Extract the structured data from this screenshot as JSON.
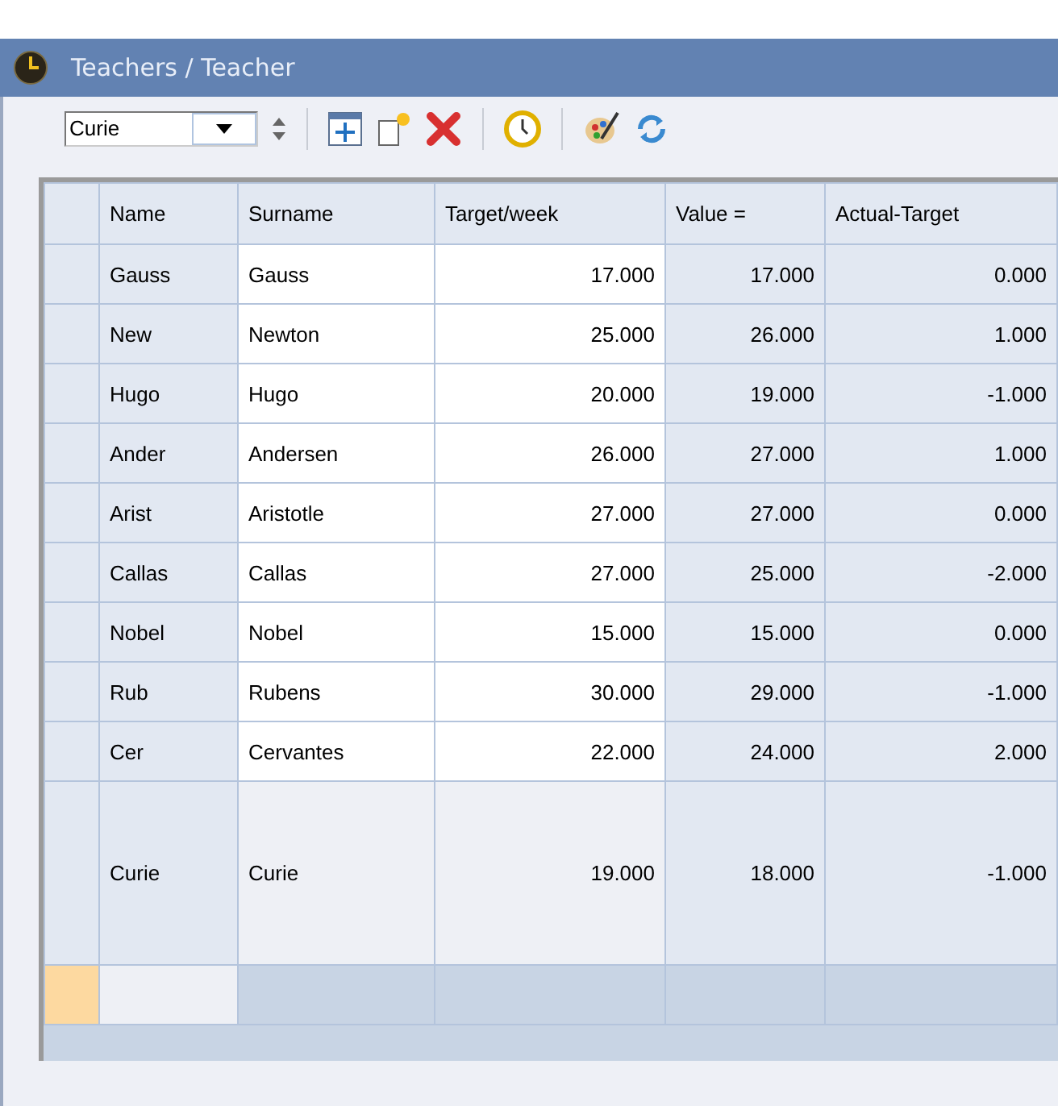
{
  "window": {
    "title": "Teachers / Teacher"
  },
  "toolbar": {
    "selector": {
      "value": "Curie"
    }
  },
  "table": {
    "columns": [
      {
        "label": "Name",
        "kind": "label"
      },
      {
        "label": "Surname",
        "kind": "text"
      },
      {
        "label": "Target/week",
        "kind": "amount"
      },
      {
        "label": "Value =",
        "kind": "computed"
      },
      {
        "label": "Actual-Target",
        "kind": "computed"
      }
    ],
    "rows": [
      {
        "selected": false,
        "cells": [
          "Gauss",
          "Gauss",
          "17.000",
          "17.000",
          "0.000"
        ]
      },
      {
        "selected": false,
        "cells": [
          "New",
          "Newton",
          "25.000",
          "26.000",
          "1.000"
        ]
      },
      {
        "selected": false,
        "cells": [
          "Hugo",
          "Hugo",
          "20.000",
          "19.000",
          "-1.000"
        ]
      },
      {
        "selected": false,
        "cells": [
          "Ander",
          "Andersen",
          "26.000",
          "27.000",
          "1.000"
        ]
      },
      {
        "selected": false,
        "cells": [
          "Arist",
          "Aristotle",
          "27.000",
          "27.000",
          "0.000"
        ]
      },
      {
        "selected": false,
        "cells": [
          "Callas",
          "Callas",
          "27.000",
          "25.000",
          "-2.000"
        ]
      },
      {
        "selected": false,
        "cells": [
          "Nobel",
          "Nobel",
          "15.000",
          "15.000",
          "0.000"
        ]
      },
      {
        "selected": false,
        "cells": [
          "Rub",
          "Rubens",
          "30.000",
          "29.000",
          "-1.000"
        ]
      },
      {
        "selected": false,
        "cells": [
          "Cer",
          "Cervantes",
          "22.000",
          "24.000",
          "2.000"
        ]
      },
      {
        "selected": true,
        "cells": [
          "Curie",
          "Curie",
          "19.000",
          "18.000",
          "-1.000"
        ]
      }
    ]
  }
}
